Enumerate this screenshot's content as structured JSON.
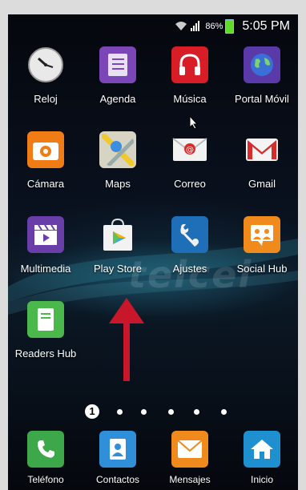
{
  "status_bar": {
    "battery_percent": "86%",
    "time": "5:05 PM",
    "wifi_icon": "wifi-icon",
    "signal_icon": "signal-icon",
    "battery_color": "#5fdc2a"
  },
  "watermark": "telcel",
  "apps": [
    {
      "label": "Reloj",
      "icon": "clock-icon"
    },
    {
      "label": "Agenda",
      "icon": "agenda-icon"
    },
    {
      "label": "Música",
      "icon": "headphones-icon"
    },
    {
      "label": "Portal Móvil",
      "icon": "globe-icon"
    },
    {
      "label": "Cámara",
      "icon": "camera-icon"
    },
    {
      "label": "Maps",
      "icon": "map-icon"
    },
    {
      "label": "Correo",
      "icon": "email-icon"
    },
    {
      "label": "Gmail",
      "icon": "gmail-icon"
    },
    {
      "label": "Multimedia",
      "icon": "clapperboard-icon"
    },
    {
      "label": "Play Store",
      "icon": "play-store-icon"
    },
    {
      "label": "Ajustes",
      "icon": "wrench-icon"
    },
    {
      "label": "Social Hub",
      "icon": "social-hub-icon"
    },
    {
      "label": "Readers Hub",
      "icon": "book-icon"
    }
  ],
  "page_indicator": {
    "current": "1",
    "total_pages": 6
  },
  "dock": [
    {
      "label": "Teléfono",
      "icon": "phone-icon"
    },
    {
      "label": "Contactos",
      "icon": "contacts-icon"
    },
    {
      "label": "Mensajes",
      "icon": "envelope-icon"
    },
    {
      "label": "Inicio",
      "icon": "home-icon"
    }
  ],
  "colors": {
    "arrow": "#c8162b",
    "accent_green": "#5fdc2a"
  }
}
